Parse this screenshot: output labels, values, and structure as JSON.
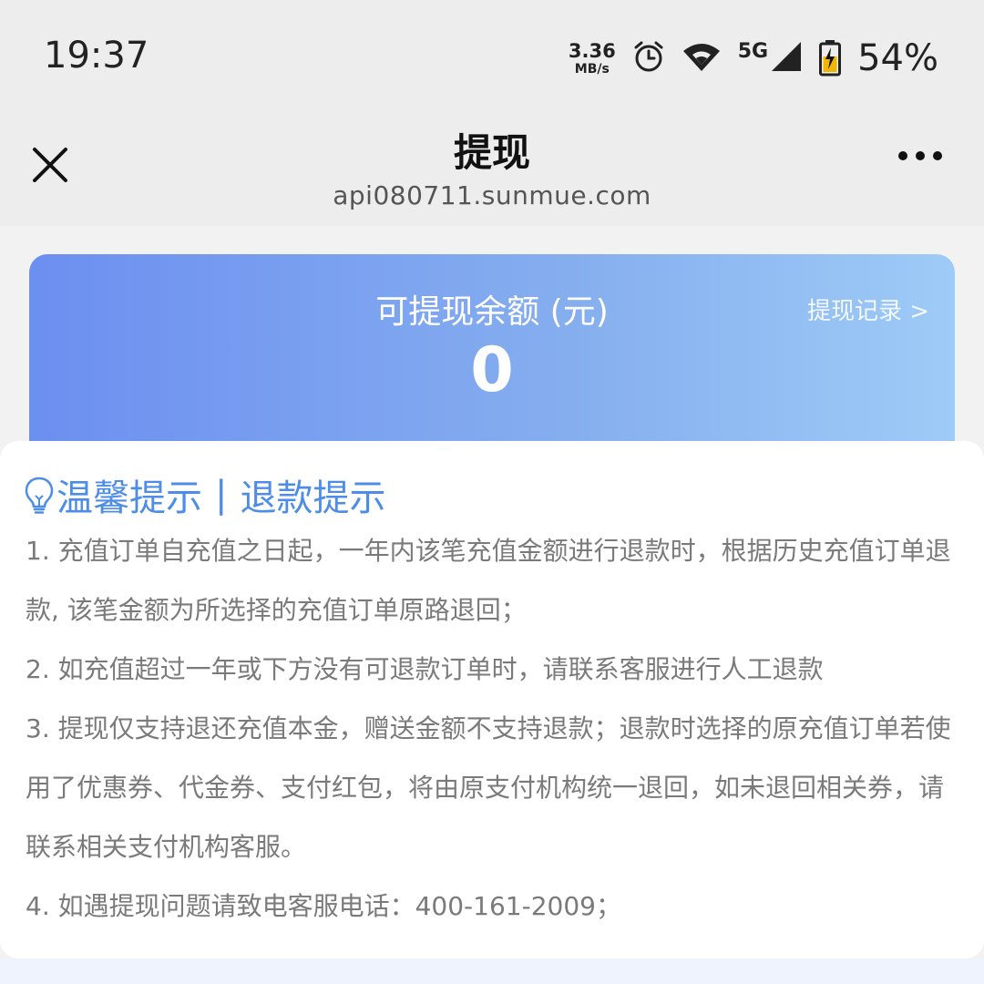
{
  "status_bar": {
    "time": "19:37",
    "net_speed_value": "3.36",
    "net_speed_unit": "MB/s",
    "network_type": "5G",
    "battery_percent": "54%",
    "icons": [
      "alarm-icon",
      "wifi-icon",
      "signal-icon",
      "battery-charging-icon"
    ]
  },
  "nav": {
    "title": "提现",
    "domain": "api080711.sunmue.com",
    "close_icon": "close-icon",
    "more_icon": "more-icon"
  },
  "balance": {
    "label": "可提现余额 (元)",
    "amount": "0",
    "history_link": "提现记录 >"
  },
  "tips": {
    "heading_left": "温馨提示",
    "heading_sep": "|",
    "heading_right": "退款提示",
    "heading_icon": "lightbulb-icon",
    "items": [
      "1. 充值订单自充值之日起，一年内该笔充值金额进行退款时，根据历史充值订单退款, 该笔金额为所选择的充值订单原路退回；",
      "2. 如充值超过一年或下方没有可退款订单时，请联系客服进行人工退款",
      "3. 提现仅支持退还充值本金，赠送金额不支持退款；退款时选择的原充值订单若使用了优惠券、代金券、支付红包，将由原支付机构统一退回，如未退回相关券，请联系相关支付机构客服。",
      "4. 如遇提现问题请致电客服电话：400-161-2009；"
    ]
  },
  "colors": {
    "accent": "#4d8de8",
    "card_gradient_start": "#6c8ff0",
    "card_gradient_end": "#9ecbf7",
    "tip_text": "#7a7a7a"
  }
}
